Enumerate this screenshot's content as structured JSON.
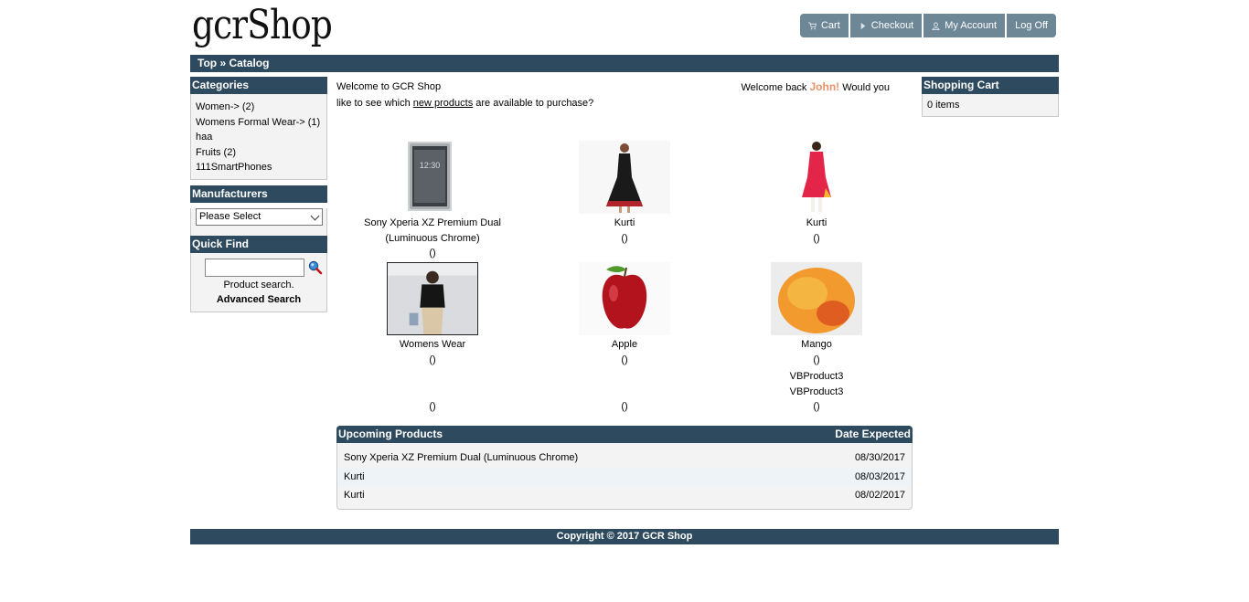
{
  "header": {
    "logo": "gcrShop",
    "nav": [
      {
        "label": "Cart",
        "icon": "cart-icon"
      },
      {
        "label": "Checkout",
        "icon": "triangle-right-icon"
      },
      {
        "label": "My Account",
        "icon": "person-icon"
      },
      {
        "label": "Log Off",
        "icon": ""
      }
    ]
  },
  "breadcrumb": {
    "top": "Top",
    "sep": " » ",
    "current": "Catalog"
  },
  "categories": {
    "title": "Categories",
    "items": [
      "Women-> (2)",
      "Womens Formal Wear-> (1)",
      "haa",
      "Fruits (2)",
      "111SmartPhones"
    ]
  },
  "manufacturers": {
    "title": "Manufacturers",
    "selected": "Please Select"
  },
  "quick_find": {
    "title": "Quick Find",
    "hint": "Product search.",
    "advanced": "Advanced Search"
  },
  "welcome": {
    "line1_left": "Welcome to GCR Shop",
    "line1_right_pre": "Welcome back ",
    "name": "John!",
    "line1_right_post": " Would you",
    "line2_pre": "like to see which ",
    "link": "new products",
    "line2_post": " are available to purchase?"
  },
  "products": [
    {
      "name": "Sony Xperia XZ Premium Dual (Luminuous Chrome)",
      "price": "()"
    },
    {
      "name": "Kurti",
      "price": "()"
    },
    {
      "name": "Kurti",
      "price": "()"
    },
    {
      "name": "Womens Wear",
      "price": "()"
    },
    {
      "name": "Apple",
      "price": "()"
    },
    {
      "name": "Mango",
      "price": "()"
    }
  ],
  "extra": {
    "vb1": "VBProduct3",
    "vb2": "VBProduct3",
    "p1": "()",
    "p2": "()",
    "p3": "()"
  },
  "upcoming": {
    "title": "Upcoming Products",
    "date_header": "Date Expected",
    "rows": [
      {
        "name": "Sony Xperia XZ Premium Dual (Luminuous Chrome)",
        "date": "08/30/2017"
      },
      {
        "name": "Kurti",
        "date": "08/03/2017"
      },
      {
        "name": "Kurti",
        "date": "08/02/2017"
      }
    ]
  },
  "shopping_cart": {
    "title": "Shopping Cart",
    "items": "0 items"
  },
  "footer": {
    "copyright": "Copyright © 2017 GCR Shop"
  },
  "colors": {
    "bar": "#2d4a5e",
    "nav_button": "#6e8797",
    "accent_name": "#e8916c",
    "box_bg": "#f3f3f3"
  }
}
